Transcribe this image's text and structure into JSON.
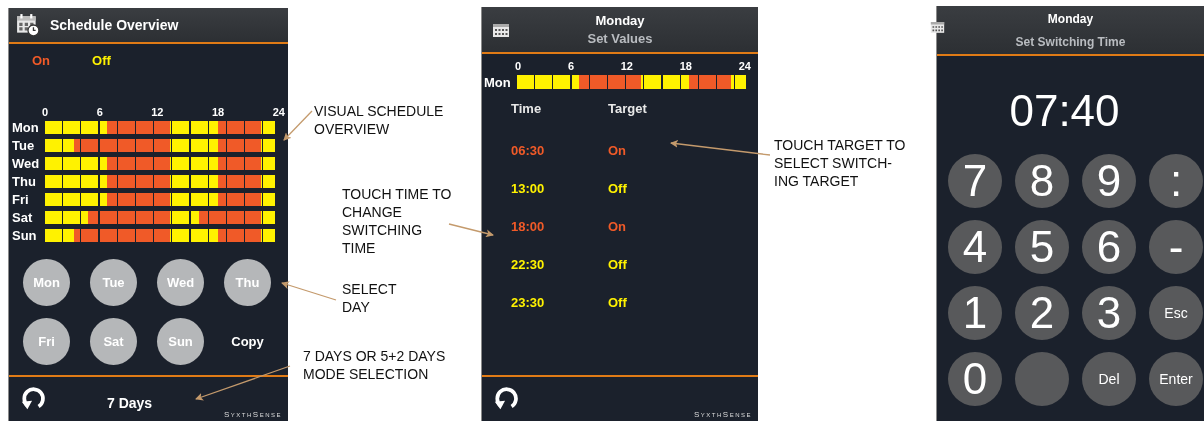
{
  "schedule_overview": {
    "title": "Schedule Overview",
    "legend": [
      {
        "label": "On",
        "color": "#f05a28"
      },
      {
        "label": "Off",
        "color": "#fff200"
      }
    ],
    "hours": [
      "0",
      "6",
      "12",
      "18",
      "24"
    ],
    "days": [
      {
        "label": "Mon",
        "slots": [
          false,
          false,
          false,
          false,
          false,
          false,
          false,
          false,
          false,
          false,
          false,
          false,
          false,
          true,
          true,
          true,
          true,
          true,
          true,
          true,
          true,
          true,
          true,
          true,
          true,
          true,
          false,
          false,
          false,
          false,
          false,
          false,
          false,
          false,
          false,
          false,
          true,
          true,
          true,
          true,
          true,
          true,
          true,
          true,
          true,
          false,
          false,
          false
        ]
      },
      {
        "label": "Tue",
        "slots": [
          false,
          false,
          false,
          false,
          false,
          false,
          true,
          true,
          true,
          true,
          true,
          true,
          true,
          true,
          true,
          true,
          true,
          true,
          true,
          true,
          true,
          true,
          true,
          true,
          true,
          true,
          false,
          false,
          false,
          false,
          false,
          false,
          false,
          false,
          false,
          false,
          true,
          true,
          true,
          true,
          true,
          true,
          true,
          true,
          true,
          false,
          false,
          false
        ]
      },
      {
        "label": "Wed",
        "slots": [
          false,
          false,
          false,
          false,
          false,
          false,
          false,
          false,
          false,
          false,
          false,
          false,
          false,
          true,
          true,
          true,
          true,
          true,
          true,
          true,
          true,
          true,
          true,
          true,
          true,
          true,
          false,
          false,
          false,
          false,
          false,
          false,
          false,
          false,
          false,
          false,
          true,
          true,
          true,
          true,
          true,
          true,
          true,
          true,
          true,
          false,
          false,
          false
        ]
      },
      {
        "label": "Thu",
        "slots": [
          false,
          false,
          false,
          false,
          false,
          false,
          false,
          false,
          false,
          false,
          false,
          false,
          false,
          true,
          true,
          true,
          true,
          true,
          true,
          true,
          true,
          true,
          true,
          true,
          true,
          true,
          false,
          false,
          false,
          false,
          false,
          false,
          false,
          false,
          false,
          false,
          true,
          true,
          true,
          true,
          true,
          true,
          true,
          true,
          true,
          false,
          false,
          false
        ]
      },
      {
        "label": "Fri",
        "slots": [
          false,
          false,
          false,
          false,
          false,
          false,
          false,
          false,
          false,
          false,
          false,
          false,
          false,
          true,
          true,
          true,
          true,
          true,
          true,
          true,
          true,
          true,
          true,
          true,
          true,
          true,
          false,
          false,
          false,
          false,
          false,
          false,
          false,
          false,
          false,
          false,
          true,
          true,
          true,
          true,
          true,
          true,
          true,
          true,
          true,
          false,
          false,
          false
        ]
      },
      {
        "label": "Sat",
        "slots": [
          false,
          false,
          false,
          false,
          false,
          false,
          false,
          false,
          false,
          true,
          true,
          true,
          true,
          true,
          true,
          true,
          true,
          true,
          true,
          true,
          true,
          true,
          true,
          true,
          true,
          true,
          false,
          false,
          false,
          false,
          false,
          false,
          true,
          true,
          true,
          true,
          true,
          true,
          true,
          true,
          true,
          true,
          true,
          true,
          true,
          false,
          false,
          false
        ]
      },
      {
        "label": "Sun",
        "slots": [
          false,
          false,
          false,
          false,
          false,
          false,
          true,
          true,
          true,
          true,
          true,
          true,
          true,
          true,
          true,
          true,
          true,
          true,
          true,
          true,
          true,
          true,
          true,
          true,
          true,
          true,
          false,
          false,
          false,
          false,
          false,
          false,
          false,
          false,
          false,
          false,
          true,
          true,
          true,
          true,
          true,
          true,
          true,
          true,
          true,
          false,
          false,
          false
        ]
      }
    ],
    "day_buttons": [
      "Mon",
      "Tue",
      "Wed",
      "Thu",
      "Fri",
      "Sat",
      "Sun"
    ],
    "copy": "Copy",
    "mode": "7 Days",
    "logo": "SyxthSense"
  },
  "set_values": {
    "day": "Monday",
    "title": "Set Values",
    "hours": [
      "0",
      "6",
      "12",
      "18",
      "24"
    ],
    "bar": {
      "label": "Mon",
      "slots": [
        false,
        false,
        false,
        false,
        false,
        false,
        false,
        false,
        false,
        false,
        false,
        false,
        false,
        true,
        true,
        true,
        true,
        true,
        true,
        true,
        true,
        true,
        true,
        true,
        true,
        true,
        false,
        false,
        false,
        false,
        false,
        false,
        false,
        false,
        false,
        false,
        true,
        true,
        true,
        true,
        true,
        true,
        true,
        true,
        true,
        false,
        false,
        false
      ]
    },
    "columns": [
      "Time",
      "Target"
    ],
    "rows": [
      {
        "time": "06:30",
        "target": "On",
        "on": true
      },
      {
        "time": "13:00",
        "target": "Off",
        "on": false
      },
      {
        "time": "18:00",
        "target": "On",
        "on": true
      },
      {
        "time": "22:30",
        "target": "Off",
        "on": false
      },
      {
        "time": "23:30",
        "target": "Off",
        "on": false
      }
    ],
    "logo": "SyxthSense"
  },
  "set_switching_time": {
    "day": "Monday",
    "title": "Set Switching Time",
    "value": "07:40",
    "keys": [
      {
        "label": "7",
        "kind": "digit"
      },
      {
        "label": "8",
        "kind": "digit"
      },
      {
        "label": "9",
        "kind": "digit"
      },
      {
        "label": ":",
        "kind": "digit"
      },
      {
        "label": "4",
        "kind": "digit"
      },
      {
        "label": "5",
        "kind": "digit"
      },
      {
        "label": "6",
        "kind": "digit"
      },
      {
        "label": "-",
        "kind": "digit"
      },
      {
        "label": "1",
        "kind": "digit"
      },
      {
        "label": "2",
        "kind": "digit"
      },
      {
        "label": "3",
        "kind": "digit"
      },
      {
        "label": "Esc",
        "kind": "word"
      },
      {
        "label": "0",
        "kind": "digit"
      },
      {
        "kind": "blank"
      },
      {
        "label": "Del",
        "kind": "word"
      },
      {
        "label": "Enter",
        "kind": "word"
      }
    ]
  },
  "annotations": [
    {
      "lines": [
        "VISUAL SCHEDULE",
        "OVERVIEW"
      ]
    },
    {
      "lines": [
        "TOUCH TIME TO",
        "CHANGE",
        "SWITCHING",
        "TIME"
      ]
    },
    {
      "lines": [
        "SELECT",
        "DAY"
      ]
    },
    {
      "lines": [
        "7 DAYS OR 5+2 DAYS",
        "MODE SELECTION"
      ]
    },
    {
      "lines": [
        "TOUCH TARGET TO",
        "SELECT SWITCH-",
        "ING TARGET"
      ]
    }
  ]
}
